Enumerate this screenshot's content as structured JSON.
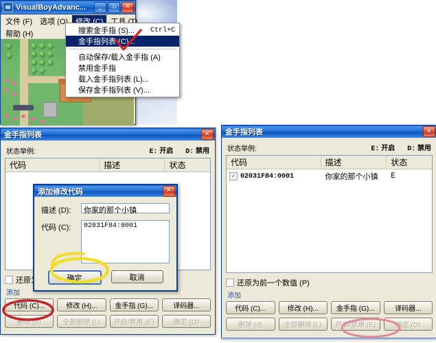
{
  "emulator": {
    "title": "VisualBoyAdvanc...",
    "sysicon": "app-icon",
    "window_buttons": {
      "minimize": "_",
      "maximize": "▫",
      "close": "✕"
    },
    "menus": [
      {
        "label": "文件 (F)",
        "selected": false
      },
      {
        "label": "选项 (O)",
        "selected": false
      },
      {
        "label": "修改 (C)",
        "selected": true
      },
      {
        "label": "工具 (T)",
        "selected": false
      },
      {
        "label": "帮助 (H)",
        "selected": false
      }
    ],
    "dropdown": {
      "items": [
        {
          "label": "搜索金手指 (S)...",
          "accel": "Ctrl+C",
          "highlighted": false,
          "separator_after": false
        },
        {
          "label": "金手指列表 (C)...",
          "accel": "",
          "highlighted": true,
          "separator_after": true
        },
        {
          "label": "自动保存/载入金手指 (A)",
          "accel": "",
          "highlighted": false,
          "separator_after": false
        },
        {
          "label": "禁用金手指",
          "accel": "",
          "highlighted": false,
          "separator_after": false
        },
        {
          "label": "载入金手指列表 (L)...",
          "accel": "",
          "highlighted": false,
          "separator_after": false
        },
        {
          "label": "保存金手指列表 (V)...",
          "accel": "",
          "highlighted": false,
          "separator_after": false
        }
      ]
    }
  },
  "cheat_list_left": {
    "title": "金手指列表",
    "close_label": "✕",
    "legend_label": "状态举例:",
    "legend_enabled_key": "E:",
    "legend_enabled_value": "开启",
    "legend_disabled_key": "D:",
    "legend_disabled_value": "禁用",
    "columns": [
      "代码",
      "描述",
      "状态"
    ],
    "rows": [],
    "restore_checkbox_label": "还原为前一个数值 (P)",
    "restore_checked": false,
    "group_label": "添加",
    "add_buttons": [
      "代码 (C)...",
      "修改 (H)...",
      "金手指 (G)...",
      "译码器..."
    ],
    "action_buttons": [
      "删除 (d)",
      "全部删除 (L)",
      "开启/禁用 (E)",
      "确定 (O)"
    ],
    "action_buttons_disabled": true
  },
  "cheat_list_right": {
    "title": "金手指列表",
    "close_label": "✕",
    "legend_label": "状态举例:",
    "legend_enabled_key": "E:",
    "legend_enabled_value": "开启",
    "legend_disabled_key": "D:",
    "legend_disabled_value": "禁用",
    "columns": [
      "代码",
      "描述",
      "状态"
    ],
    "rows": [
      {
        "checked": true,
        "check_glyph": "✓",
        "code": "02031F84:0001",
        "description": "你家的那个小镇",
        "status": "E"
      }
    ],
    "restore_checkbox_label": "还原为前一个数值 (P)",
    "restore_checked": false,
    "group_label": "添加",
    "add_buttons": [
      "代码 (C)...",
      "修改 (H)...",
      "金手指 (G)...",
      "译码器..."
    ],
    "action_buttons": [
      "删除 (d)",
      "全部删除 (L)",
      "开启/禁用 (E)",
      "确定 (O)"
    ],
    "action_buttons_disabled": true
  },
  "add_code_dialog": {
    "title": "添加修改代码",
    "close_label": "✕",
    "description_label": "描述 (D):",
    "description_value": "你家的那个小镇",
    "code_label": "代码 (C):",
    "code_value": "02031F84:0001",
    "ok_label": "确定",
    "cancel_label": "取消"
  },
  "annotations": {
    "red_arrow_color": "#d32020",
    "yellow_ellipse_color": "#f2dd2a",
    "red_ellipse_color": "#c0262a",
    "pink_ellipse_color": "#e08a94"
  }
}
